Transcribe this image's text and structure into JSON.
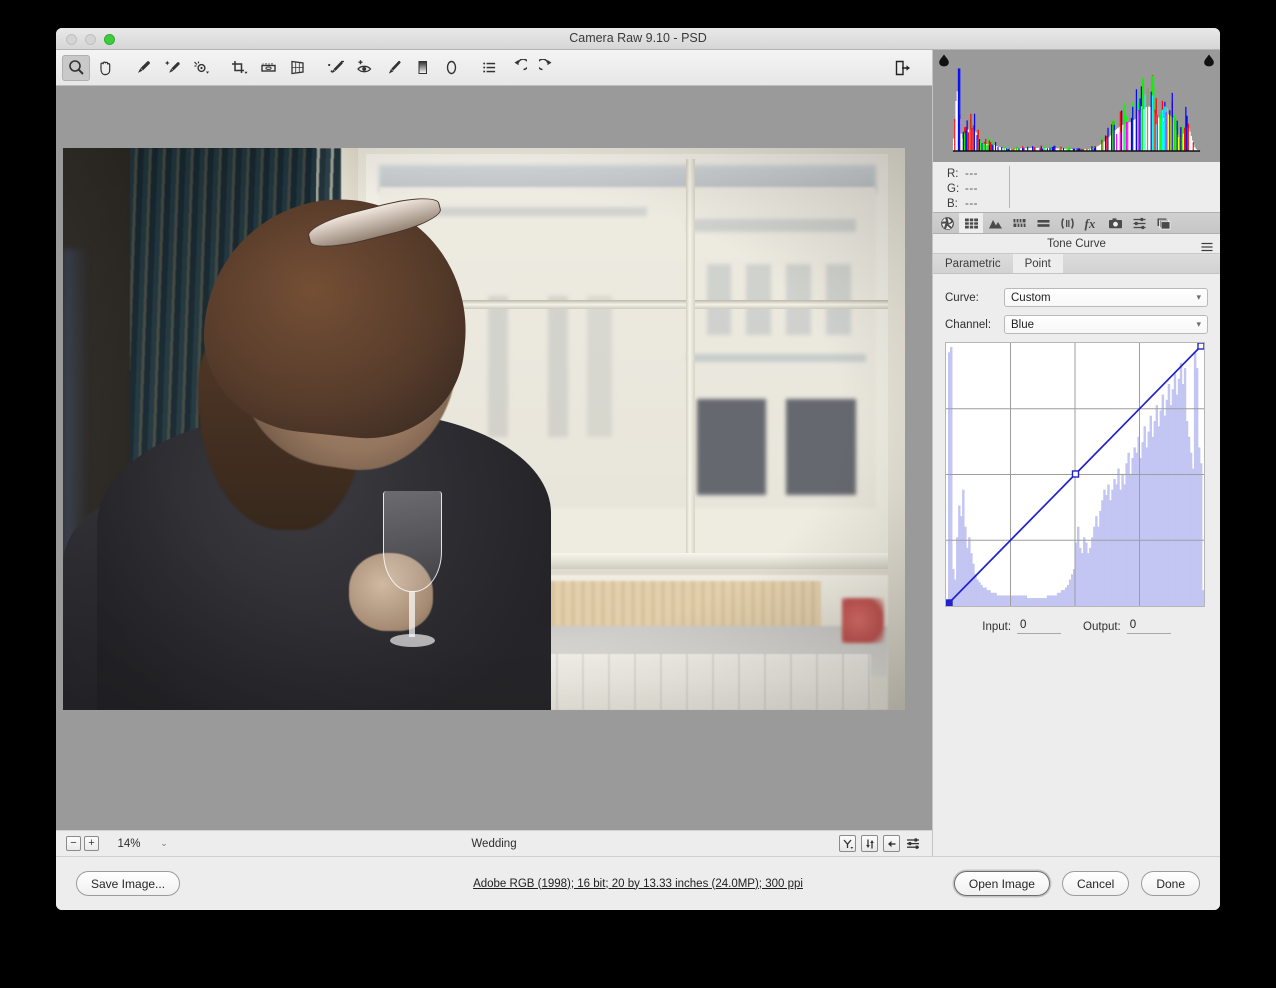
{
  "window": {
    "title": "Camera Raw 9.10  -  PSD",
    "traffic_lights": [
      "close-button",
      "minimize-button",
      "zoom-button"
    ]
  },
  "toolbar": {
    "tools": [
      {
        "name": "zoom-tool",
        "icon": "magnifier-icon",
        "active": true
      },
      {
        "name": "hand-tool",
        "icon": "hand-icon",
        "active": false
      },
      {
        "name": "white-balance-tool",
        "icon": "eyedropper-icon",
        "active": false
      },
      {
        "name": "color-sampler-tool",
        "icon": "color-sampler-icon",
        "active": false
      },
      {
        "name": "targeted-adjustment-tool",
        "icon": "target-adjust-icon",
        "active": false
      },
      {
        "name": "crop-tool",
        "icon": "crop-icon",
        "active": false
      },
      {
        "name": "straighten-tool",
        "icon": "straighten-icon",
        "active": false
      },
      {
        "name": "transform-tool",
        "icon": "transform-grid-icon",
        "active": false
      },
      {
        "name": "spot-removal-tool",
        "icon": "spot-removal-icon",
        "active": false
      },
      {
        "name": "red-eye-removal-tool",
        "icon": "red-eye-icon",
        "active": false
      },
      {
        "name": "adjustment-brush-tool",
        "icon": "brush-icon",
        "active": false
      },
      {
        "name": "graduated-filter-tool",
        "icon": "gradient-icon",
        "active": false
      },
      {
        "name": "radial-filter-tool",
        "icon": "ellipse-icon",
        "active": false
      },
      {
        "name": "preferences-tool",
        "icon": "list-lines-icon",
        "active": false
      },
      {
        "name": "rotate-left-tool",
        "icon": "rotate-ccw-icon",
        "active": false
      },
      {
        "name": "rotate-right-tool",
        "icon": "rotate-cw-icon",
        "active": false
      }
    ],
    "open_preferences": {
      "name": "toggle-filmstrip-button",
      "icon": "panel-exit-icon"
    }
  },
  "preview": {
    "photo_alt": "Woman in dark knit robe seated by a bright window, sunglasses on her head, holding a champagne flute",
    "status": {
      "zoom_out_label": "−",
      "zoom_in_label": "+",
      "zoom_level": "14%",
      "zoom_caret": "⌄",
      "filename": "Wedding",
      "right_buttons": [
        {
          "name": "preview-toggle-button",
          "icon": "y-preview-icon"
        },
        {
          "name": "before-after-button",
          "icon": "swap-vertical-icon"
        },
        {
          "name": "copy-current-to-before-button",
          "icon": "arrow-left-box-icon"
        },
        {
          "name": "preview-preferences-button",
          "icon": "sliders-icon"
        }
      ]
    }
  },
  "right_panel": {
    "histogram": {
      "name": "histogram",
      "shadow_clipping_indicator": "shadow-clipping-icon",
      "highlight_clipping_indicator": "highlight-clipping-icon"
    },
    "rgb_readout": [
      {
        "label": "R:",
        "value": "---"
      },
      {
        "label": "G:",
        "value": "---"
      },
      {
        "label": "B:",
        "value": "---"
      }
    ],
    "panel_tabs": [
      {
        "name": "tab-basic",
        "icon": "aperture-icon",
        "active": false
      },
      {
        "name": "tab-tone-curve",
        "icon": "tone-curve-grid-icon",
        "active": true
      },
      {
        "name": "tab-detail",
        "icon": "mountains-icon",
        "active": false
      },
      {
        "name": "tab-hsl-grayscale",
        "icon": "hsl-bars-icon",
        "active": false
      },
      {
        "name": "tab-split-toning",
        "icon": "split-tone-icon",
        "active": false
      },
      {
        "name": "tab-lens-corrections",
        "icon": "lens-aperture-icon",
        "active": false
      },
      {
        "name": "tab-effects",
        "icon": "fx-icon",
        "active": false
      },
      {
        "name": "tab-camera-calibration",
        "icon": "camera-icon",
        "active": false
      },
      {
        "name": "tab-presets",
        "icon": "sliders-preset-icon",
        "active": false
      },
      {
        "name": "tab-snapshots",
        "icon": "stacked-layers-icon",
        "active": false
      }
    ],
    "panel_title": "Tone Curve",
    "panel_menu_icon": "hamburger-menu-icon",
    "subtabs": [
      {
        "name": "subtab-parametric",
        "label": "Parametric",
        "active": false
      },
      {
        "name": "subtab-point",
        "label": "Point",
        "active": true
      }
    ],
    "curve_field": {
      "label": "Curve:",
      "value": "Custom"
    },
    "channel_field": {
      "label": "Channel:",
      "value": "Blue"
    },
    "input_field": {
      "label": "Input:",
      "value": "0"
    },
    "output_field": {
      "label": "Output:",
      "value": "0"
    }
  },
  "footer": {
    "save_image_label": "Save Image...",
    "workflow_options": "Adobe RGB (1998); 16 bit; 20 by 13.33 inches (24.0MP); 300 ppi",
    "open_image_label": "Open Image",
    "cancel_label": "Cancel",
    "done_label": "Done"
  },
  "colors": {
    "panel_bg": "#ededed",
    "preview_bg": "#9a9a9a",
    "curve_line": "#2222cc",
    "curve_histogram_fill": "#c3c5f2",
    "accent_green": "#3ecc3e"
  },
  "chart_data": {
    "type": "line",
    "title": "Tone Curve - Blue Channel (Point)",
    "xlabel": "Input",
    "ylabel": "Output",
    "xlim": [
      0,
      255
    ],
    "ylim": [
      0,
      255
    ],
    "grid": true,
    "legend": "none",
    "curve_points": [
      {
        "input": 0,
        "output": 0
      },
      {
        "input": 128,
        "output": 128
      },
      {
        "input": 255,
        "output": 255
      }
    ],
    "identity_reference": true,
    "background_histogram": {
      "channel": "Blue",
      "bins": [
        2,
        96,
        98,
        14,
        10,
        26,
        38,
        34,
        44,
        30,
        22,
        26,
        20,
        16,
        12,
        10,
        9,
        8,
        7,
        7,
        6,
        6,
        5,
        5,
        5,
        4,
        4,
        4,
        4,
        4,
        4,
        4,
        4,
        4,
        4,
        4,
        4,
        4,
        4,
        4,
        3,
        3,
        3,
        3,
        3,
        3,
        3,
        3,
        3,
        3,
        4,
        4,
        4,
        4,
        4,
        5,
        5,
        6,
        6,
        7,
        8,
        10,
        12,
        14,
        24,
        30,
        22,
        20,
        26,
        24,
        20,
        22,
        26,
        30,
        34,
        30,
        36,
        40,
        44,
        42,
        46,
        40,
        44,
        48,
        46,
        52,
        44,
        50,
        46,
        54,
        58,
        50,
        56,
        60,
        58,
        64,
        56,
        62,
        68,
        60,
        66,
        72,
        64,
        70,
        76,
        68,
        74,
        80,
        72,
        78,
        84,
        76,
        82,
        88,
        80,
        86,
        92,
        84,
        90,
        70,
        64,
        58,
        52,
        96,
        90,
        60,
        54,
        6
      ]
    }
  },
  "histogram_data": {
    "type": "area",
    "title": "RGB Histogram",
    "xlim": [
      0,
      255
    ],
    "channels": [
      "red",
      "green",
      "blue",
      "combined"
    ],
    "notes": "Bimodal: large spike at the shadow end, broad mass in the highlights with yellow clipping near white"
  }
}
